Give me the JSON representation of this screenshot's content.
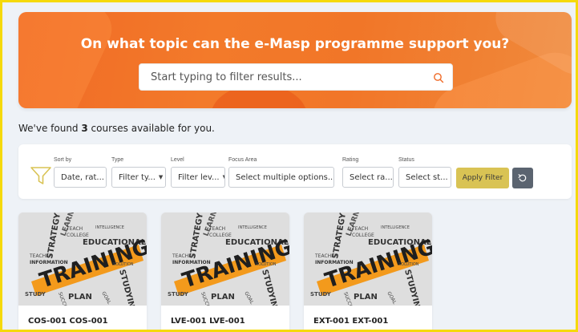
{
  "hero": {
    "title": "On what topic can the e-Masp programme support you?",
    "search_placeholder": "Start typing to filter results...",
    "accent": "#f06a26"
  },
  "results": {
    "prefix": "We've found ",
    "count": "3",
    "suffix": " courses available for you."
  },
  "filters": {
    "sort": {
      "label": "Sort by",
      "value": "Date, rat..."
    },
    "type": {
      "label": "Type",
      "value": "Filter ty..."
    },
    "level": {
      "label": "Level",
      "value": "Filter lev..."
    },
    "focus": {
      "label": "Focus Area",
      "value": "Select multiple options..."
    },
    "rating": {
      "label": "Rating",
      "value": "Select ra..."
    },
    "status": {
      "label": "Status",
      "value": "Select st..."
    },
    "apply_label": "Apply Filter",
    "apply_color": "#d9c354",
    "reset_color": "#5b6470"
  },
  "cards": [
    {
      "code": "COS-001 COS-001",
      "image_word": "TRAINING"
    },
    {
      "code": "LVE-001 LVE-001",
      "image_word": "TRAINING"
    },
    {
      "code": "EXT-001 EXT-001",
      "image_word": "TRAINING"
    }
  ],
  "card_words": {
    "strategy": "STRATEGY",
    "learn": "LEARN",
    "educational": "EDUCATIONAL",
    "information": "INFORMATION",
    "teach": "TEACH",
    "college": "COLLEGE",
    "intelligence": "INTELLIGENCE",
    "teacher": "TEACHER",
    "study": "STUDY",
    "plan": "PLAN",
    "studying": "STUDYING",
    "solution": "SOLUTION",
    "success": "SUCCESS",
    "goal": "GOAL",
    "project": "PROJECT",
    "university": "UNIVERSITY",
    "school": "SCHOOL",
    "instruction": "INSTRUCTION"
  }
}
